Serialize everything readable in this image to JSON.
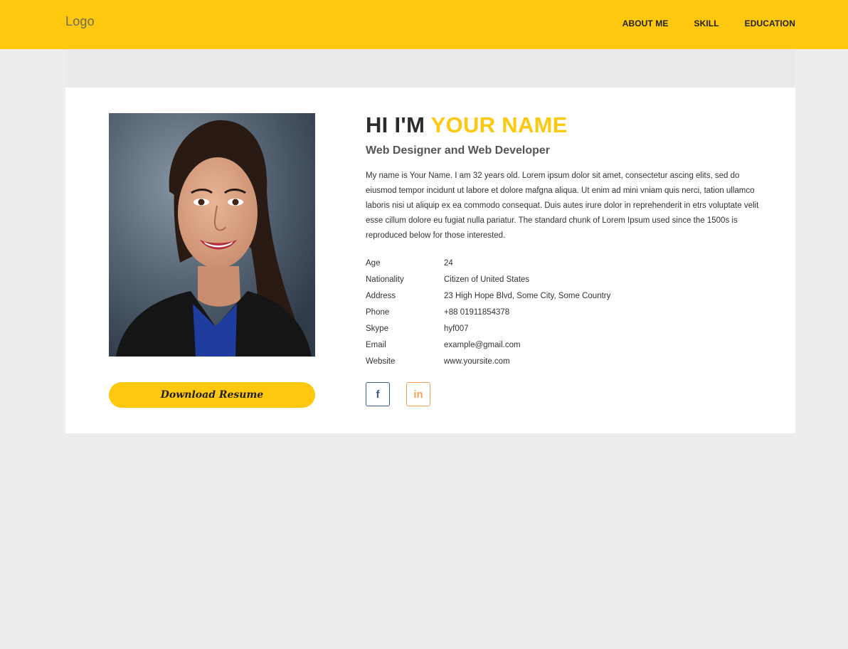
{
  "header": {
    "logo": "Logo",
    "nav": [
      {
        "label": "ABOUT ME"
      },
      {
        "label": "SKILL"
      },
      {
        "label": "EDUCATION"
      }
    ]
  },
  "profile": {
    "greeting": "HI I'M",
    "name": "YOUR NAME",
    "title": "Web Designer and Web Developer",
    "bio": "My name is Your Name. I am 32 years old. Lorem ipsum dolor sit amet, consectetur ascing elits, sed do eiusmod tempor incidunt ut labore et dolore mafgna aliqua. Ut enim ad mini vniam quis nerci, tation ullamco laboris nisi ut aliquip ex ea commodo consequat. Duis autes irure dolor in reprehenderit in etrs voluptate velit esse cillum dolore eu fugiat nulla pariatur. The standard chunk of Lorem Ipsum used since the 1500s is reproduced below for those interested.",
    "details": [
      {
        "label": "Age",
        "value": "24"
      },
      {
        "label": "Nationality",
        "value": "Citizen of United States"
      },
      {
        "label": "Address",
        "value": "23 High Hope Blvd, Some City, Some Country"
      },
      {
        "label": "Phone",
        "value": "+88 01911854378"
      },
      {
        "label": "Skype",
        "value": "hyf007"
      },
      {
        "label": "Email",
        "value": "example@gmail.com"
      },
      {
        "label": "Website",
        "value": "www.yoursite.com"
      }
    ],
    "download_label": "Download Resume",
    "socials": [
      {
        "icon": "facebook-icon",
        "glyph": "f",
        "color": "#3b5998"
      },
      {
        "icon": "linkedin-icon",
        "glyph": "in",
        "color": "#f0a35a"
      }
    ]
  },
  "colors": {
    "accent": "#fec80f",
    "background": "#ededec",
    "card": "#ffffff"
  }
}
